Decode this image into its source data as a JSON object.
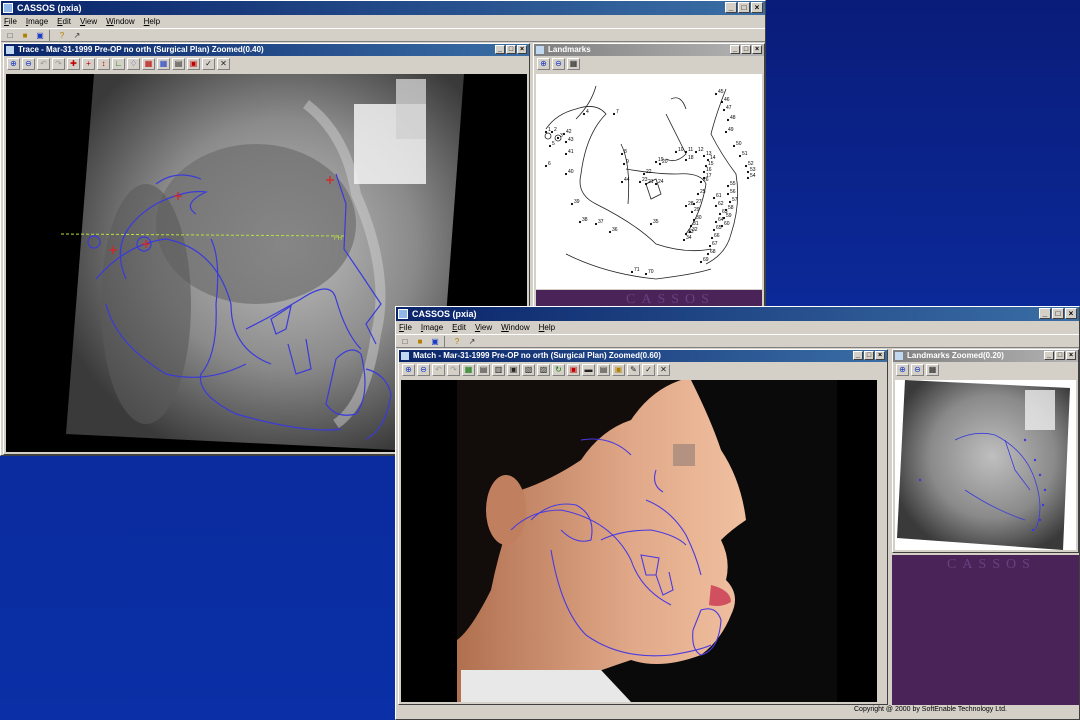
{
  "app1": {
    "title": "CASSOS (pxia)",
    "menu": [
      "File",
      "Image",
      "Edit",
      "View",
      "Window",
      "Help"
    ],
    "window_buttons": [
      "_",
      "□",
      "×"
    ]
  },
  "trace": {
    "title": "Trace - Mar-31-1999 Pre-OP no orth (Surgical Plan) Zoomed(0.40)",
    "fh_label": "FH"
  },
  "landmarks": {
    "title": "Landmarks",
    "brand": "CASSOS",
    "points": [
      "1",
      "2",
      "3",
      "4",
      "5",
      "6",
      "7",
      "8",
      "9",
      "10",
      "11",
      "12",
      "13",
      "14",
      "15",
      "16",
      "17",
      "18",
      "19",
      "20",
      "21",
      "22",
      "23",
      "24",
      "25",
      "26",
      "27",
      "28",
      "29",
      "30",
      "31",
      "32",
      "33",
      "34",
      "35",
      "36",
      "37",
      "38",
      "39",
      "40",
      "41",
      "42",
      "43",
      "44",
      "45",
      "46",
      "47",
      "48",
      "49",
      "50",
      "51",
      "52",
      "53",
      "54",
      "55",
      "56",
      "57",
      "58",
      "59",
      "60",
      "61",
      "62",
      "63",
      "64",
      "65",
      "66",
      "67",
      "68",
      "69",
      "70",
      "71"
    ]
  },
  "app2": {
    "title": "CASSOS (pxia)",
    "menu": [
      "File",
      "Image",
      "Edit",
      "View",
      "Window",
      "Help"
    ]
  },
  "match": {
    "title": "Match - Mar-31-1999 Pre-OP no orth (Surgical Plan) Zoomed(0.60)"
  },
  "landmarks_zoomed": {
    "title": "Landmarks Zoomed(0.20)",
    "brand": "CASSOS"
  },
  "status": {
    "copyright": "Copyright @ 2000 by SoftEnable Technology Ltd."
  },
  "colors": {
    "trace_line": "#3a3adc",
    "background": "#0b2a9a",
    "brand_bg": "#4a2458"
  }
}
